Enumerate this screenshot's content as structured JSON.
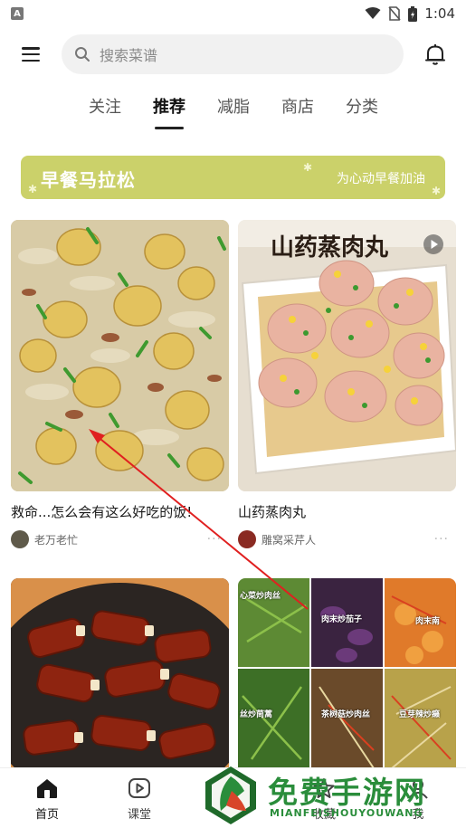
{
  "status_bar": {
    "time": "1:04",
    "app_icon_letter": "A"
  },
  "search": {
    "placeholder": "搜索菜谱"
  },
  "tabs": [
    {
      "label": "关注",
      "active": false
    },
    {
      "label": "推荐",
      "active": true
    },
    {
      "label": "减脂",
      "active": false
    },
    {
      "label": "商店",
      "active": false
    },
    {
      "label": "分类",
      "active": false
    }
  ],
  "banner": {
    "title": "早餐马拉松",
    "subtitle": "为心动早餐加油",
    "color": "#cbd16a"
  },
  "feed": [
    {
      "title": "救命...怎么会有这么好吃的饭!",
      "author": "老万老忙",
      "more": "···"
    },
    {
      "title": "山药蒸肉丸",
      "author": "雕窝采芹人",
      "more": "···",
      "image_text": "山药蒸肉丸"
    },
    {
      "grid_labels": [
        "心菜炒肉丝",
        "肉末炒茄子",
        "肉末南",
        "丝炒茼蒿",
        "茶树菇炒肉丝",
        "豆芽辣炒癞"
      ]
    }
  ],
  "bottom_nav": [
    {
      "label": "首页",
      "icon": "home-icon",
      "active": true
    },
    {
      "label": "课堂",
      "icon": "play-icon",
      "active": false
    },
    {
      "label": "收藏",
      "icon": "star-icon",
      "active": false
    },
    {
      "label": "我",
      "icon": "user-icon",
      "active": false
    }
  ],
  "watermark": {
    "text": "免费手游网",
    "sub": "MIANFEISHOUYOUWANG"
  }
}
